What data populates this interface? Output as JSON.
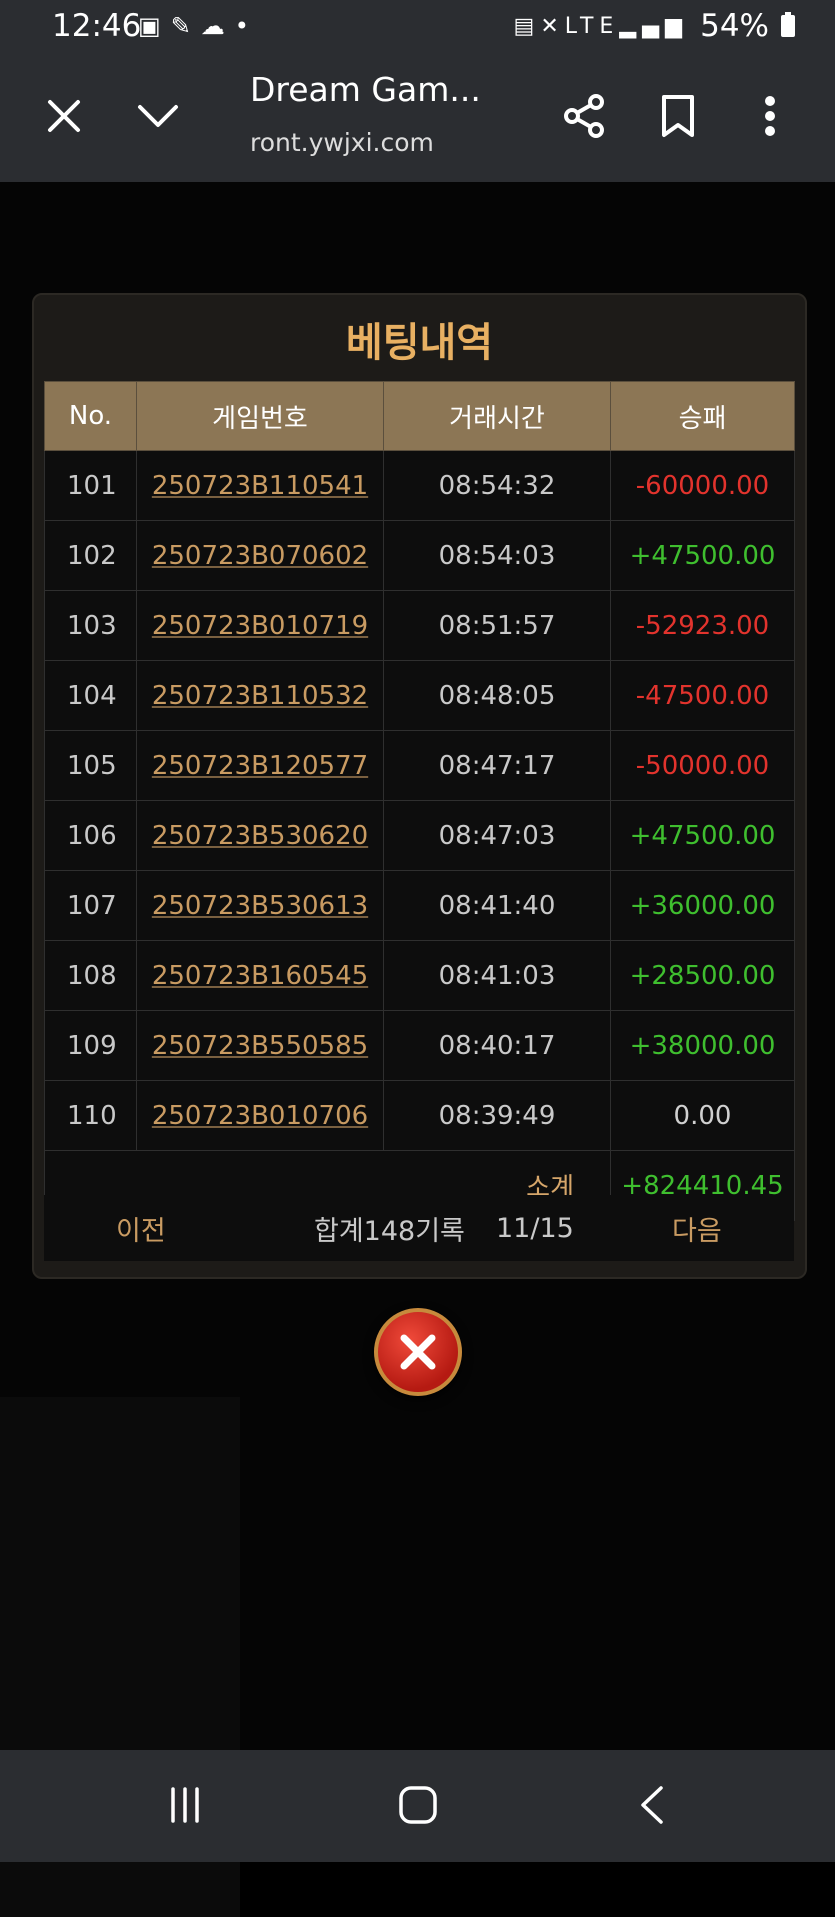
{
  "status_bar": {
    "time": "12:46",
    "battery": "54%",
    "left_icons": [
      "image-icon",
      "pen-icon",
      "cloud-icon",
      "dot-icon"
    ],
    "right_icons": [
      "lock-icon",
      "mute-icon",
      "lte-icon",
      "signal-icon",
      "battery-icon"
    ]
  },
  "browser": {
    "title": "Dream Gam...",
    "url": "ront.ywjxi.com"
  },
  "modal": {
    "title": "베팅내역",
    "columns": [
      "No.",
      "게임번호",
      "거래시간",
      "승패"
    ],
    "rows": [
      {
        "no": "101",
        "game_id": "250723B110541",
        "time": "08:54:32",
        "result": "-60000.00"
      },
      {
        "no": "102",
        "game_id": "250723B070602",
        "time": "08:54:03",
        "result": "+47500.00"
      },
      {
        "no": "103",
        "game_id": "250723B010719",
        "time": "08:51:57",
        "result": "-52923.00"
      },
      {
        "no": "104",
        "game_id": "250723B110532",
        "time": "08:48:05",
        "result": "-47500.00"
      },
      {
        "no": "105",
        "game_id": "250723B120577",
        "time": "08:47:17",
        "result": "-50000.00"
      },
      {
        "no": "106",
        "game_id": "250723B530620",
        "time": "08:47:03",
        "result": "+47500.00"
      },
      {
        "no": "107",
        "game_id": "250723B530613",
        "time": "08:41:40",
        "result": "+36000.00"
      },
      {
        "no": "108",
        "game_id": "250723B160545",
        "time": "08:41:03",
        "result": "+28500.00"
      },
      {
        "no": "109",
        "game_id": "250723B550585",
        "time": "08:40:17",
        "result": "+38000.00"
      },
      {
        "no": "110",
        "game_id": "250723B010706",
        "time": "08:39:49",
        "result": "0.00"
      }
    ],
    "subtotal_label": "소계",
    "subtotal_value": "+824410.45",
    "pager": {
      "prev": "이전",
      "total": "합계148기록",
      "page": "11/15",
      "next": "다음"
    }
  },
  "colors": {
    "accent_gold": "#e8b062",
    "header_brown": "#8c7655",
    "loss_red": "#e2332d",
    "win_green": "#3fbf2f"
  }
}
